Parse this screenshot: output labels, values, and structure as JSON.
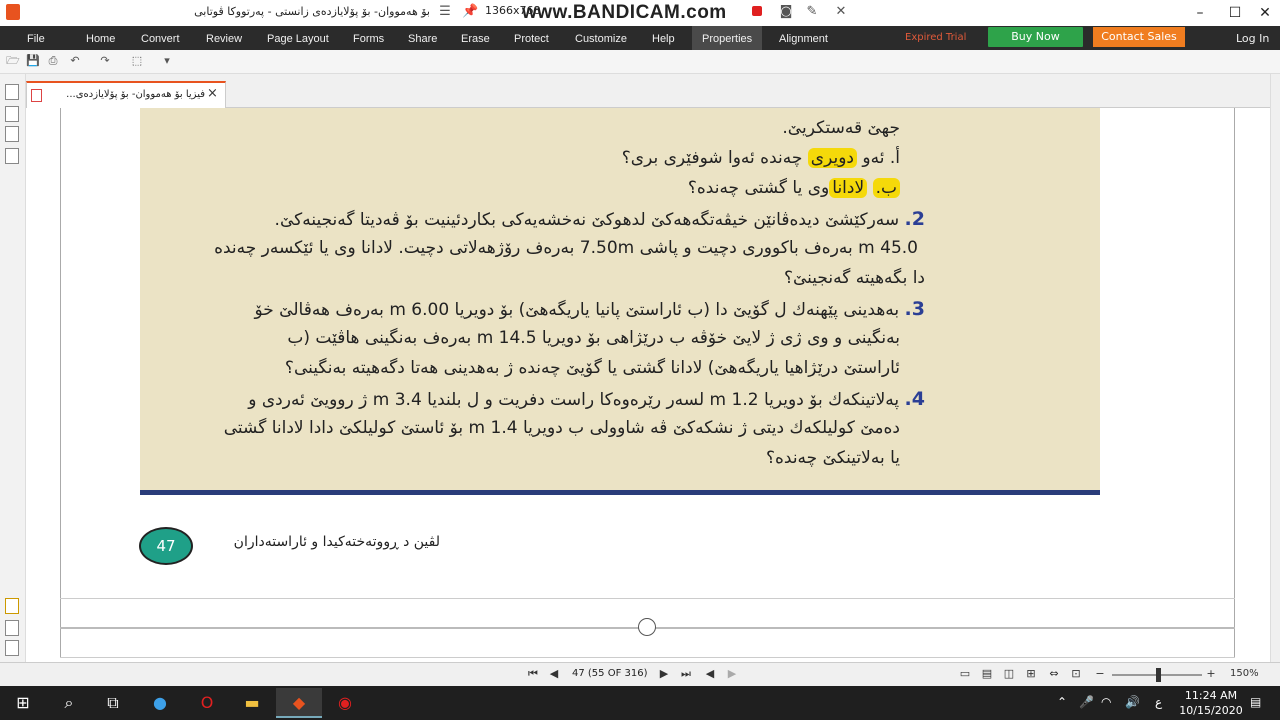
{
  "window": {
    "title": "بۆ هەمووان- بۆ پۆلایازدەی زانستی - پەرتووکا ڤوتابی",
    "resolution_label": "1366x768",
    "watermark": "www.BANDICAM.com"
  },
  "menu": {
    "file": "File",
    "items": [
      "Home",
      "Convert",
      "Review",
      "Page Layout",
      "Forms",
      "Share",
      "Erase",
      "Protect",
      "Customize",
      "Help",
      "Properties",
      "Alignment"
    ],
    "expired": "Expired Trial",
    "buy": "Buy Now",
    "contact": "Contact Sales",
    "login": "Log In"
  },
  "tab": {
    "label": "فیزیا بۆ هەمووان- بۆ پۆلایازدەی...",
    "close": "×"
  },
  "document": {
    "lines": [
      {
        "num": "",
        "text": "جهێ قەستکریێ."
      },
      {
        "num": "أ.",
        "pre": "ئەو ",
        "hl": "دویری",
        "post": " چەندە ئەوا شوفێری بری؟"
      },
      {
        "num": "",
        "hl_num": "ب.",
        "hl": "لادانا",
        "post": "وی یا گشتی چەندە؟"
      },
      {
        "num": "2.",
        "text": "سەرکێشێ دیدەڤانێن خیڤەتگەهەکێ لدهوکێ نەخشەیەکی بکاردئینیت بۆ ڤەدیتا گەنجینەکێ."
      },
      {
        "num": "",
        "text": "45.0 m بەرەف باکووری دچیت و پاشی 7.50m بەرەف رۆژهەلاتی دچیت. لادانا وی یا ئێکسەر چەندە"
      },
      {
        "num": "",
        "text": "دا بگەهیتە گەنجینێ؟"
      },
      {
        "num": "3.",
        "text": "بەهدینی پێهنەك ل گۆیێ دا (ب ئاراستێ پانیا یاریگەهێ) بۆ دویریا 6.00 m بەرەف هەڤالێ خۆ"
      },
      {
        "num": "",
        "text": "بەنگینی و وی ژی ژ لایێ خۆڤە ب درێژاهی بۆ دویریا 14.5 m بەرەف بەنگینی هاڤێت (ب"
      },
      {
        "num": "",
        "text": "ئاراستێ درێژاهیا یاریگەهێ) لادانا گشتی یا گۆیێ چەندە ژ بەهدینی هەتا دگەهیتە بەنگینی؟"
      },
      {
        "num": "4.",
        "text": "پەلاتینکەك بۆ دویریا 1.2 m لسەر رێرەوەکا راست دفریت و ل بلندیا 3.4 m ژ روویێ ئەردی و"
      },
      {
        "num": "",
        "text": "دەمێ کولیلکەك دیتی ژ نشکەکێ ڤە شاوولی ب دویریا 1.4 m بۆ ئاستێ کولیلکێ دادا لادانا گشتی"
      },
      {
        "num": "",
        "text": "یا بەلاتینکێ چەندە؟"
      }
    ],
    "page_number": "47",
    "footer_caption": "لڤین د ڕووتەختەکیدا و ئاراستەداران"
  },
  "statusbar": {
    "page_indicator": "47 (55 OF 316)",
    "zoom": "150%"
  },
  "taskbar": {
    "time": "11:24 AM",
    "date": "10/15/2020",
    "lang": "ع"
  },
  "colors": {
    "content_bg": "#ebe3c5",
    "accent_blue": "#2b3f95",
    "highlight": "#f5d90a",
    "badge": "#1fa088",
    "buy": "#2ea34a",
    "contact": "#f07d20"
  }
}
